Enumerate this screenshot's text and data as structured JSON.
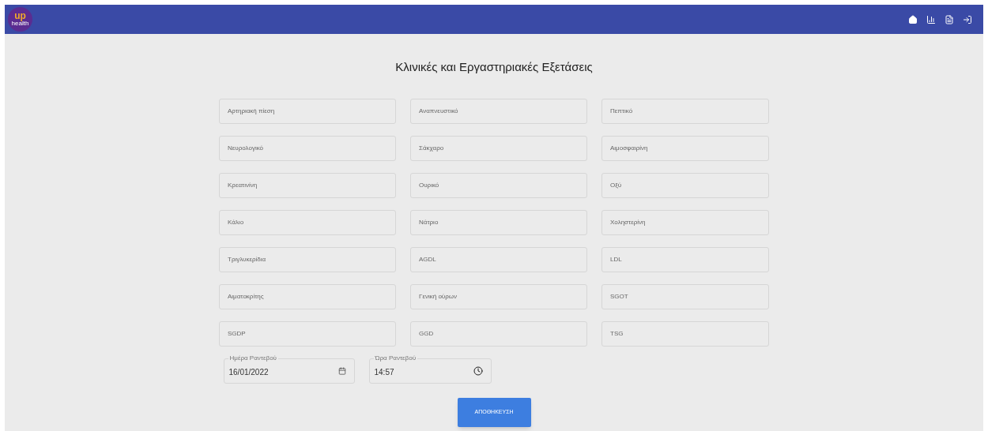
{
  "header": {
    "logo": {
      "top": "up",
      "bottom": "health"
    }
  },
  "title": "Κλινικές και Εργαστηριακές Εξετάσεις",
  "fields": [
    {
      "placeholder": "Αρτηριακή πίεση"
    },
    {
      "placeholder": "Αναπνευστικό"
    },
    {
      "placeholder": "Πεπτικό"
    },
    {
      "placeholder": "Νευρολογικό"
    },
    {
      "placeholder": "Σάκχαρο"
    },
    {
      "placeholder": "Αιμοσφαιρίνη"
    },
    {
      "placeholder": "Κρεατινίνη"
    },
    {
      "placeholder": "Ουρικό"
    },
    {
      "placeholder": "Οξύ"
    },
    {
      "placeholder": "Κάλιο"
    },
    {
      "placeholder": "Νάτριο"
    },
    {
      "placeholder": "Χοληστερίνη"
    },
    {
      "placeholder": "Τριγλυκερίδια"
    },
    {
      "placeholder": "AGDL"
    },
    {
      "placeholder": "LDL"
    },
    {
      "placeholder": "Αιματοκρίτης"
    },
    {
      "placeholder": "Γενική ούρων"
    },
    {
      "placeholder": "SGOT"
    },
    {
      "placeholder": "SGDP"
    },
    {
      "placeholder": "GGD"
    },
    {
      "placeholder": "TSG"
    }
  ],
  "date_field": {
    "label": "Ημέρα Ραντεβού",
    "value": "16/01/2022"
  },
  "time_field": {
    "label": "Ώρα Ραντεβού",
    "value": "14:57"
  },
  "save_button": "ΑΠΟΘΗΚΕΥΣΗ"
}
